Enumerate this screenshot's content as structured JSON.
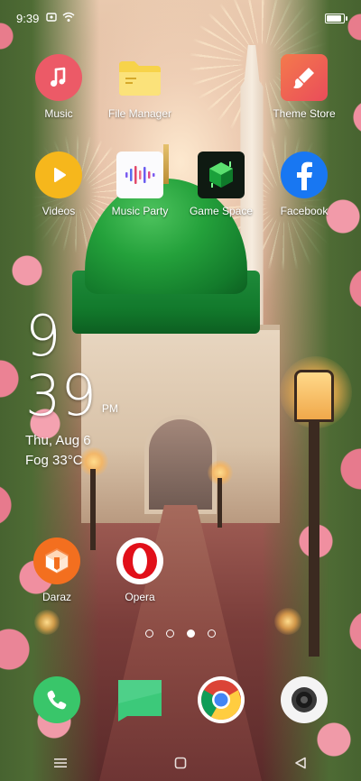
{
  "status_bar": {
    "time": "9:39",
    "battery_level": 0.9
  },
  "apps_row1": [
    {
      "label": "Music",
      "icon": "music-note-icon"
    },
    {
      "label": "File Manager",
      "icon": "folder-icon"
    },
    {
      "label": "Theme Store",
      "icon": "paintbrush-icon"
    }
  ],
  "apps_row2": [
    {
      "label": "Videos",
      "icon": "play-icon"
    },
    {
      "label": "Music Party",
      "icon": "audio-bars-icon"
    },
    {
      "label": "Game Space",
      "icon": "game-cube-icon"
    },
    {
      "label": "Facebook",
      "icon": "facebook-icon"
    }
  ],
  "apps_row3": [
    {
      "label": "Daraz",
      "icon": "daraz-icon"
    },
    {
      "label": "Opera",
      "icon": "opera-icon"
    }
  ],
  "clock": {
    "hour": "9",
    "minute": "39",
    "ampm": "PM",
    "date": "Thu, Aug 6",
    "weather": "Fog 33°C"
  },
  "page_dots": {
    "count": 4,
    "active_index": 2
  },
  "dock": [
    {
      "icon": "phone-icon"
    },
    {
      "icon": "messages-icon"
    },
    {
      "icon": "chrome-icon"
    },
    {
      "icon": "camera-icon"
    }
  ],
  "nav_bar": [
    {
      "icon": "menu-icon"
    },
    {
      "icon": "home-icon"
    },
    {
      "icon": "back-icon"
    }
  ],
  "colors": {
    "music": "#ec5a67",
    "filemanager": "#f7d34a",
    "themestore": "#f0604a",
    "videos": "#f6b71c",
    "gamespace": "#1aa13b",
    "facebook": "#1877f2",
    "daraz": "#f36f1f",
    "opera": "#e1101a",
    "phone": "#39c66a",
    "messages": "#3cc97a",
    "mosque_dome": "#24a13b"
  }
}
